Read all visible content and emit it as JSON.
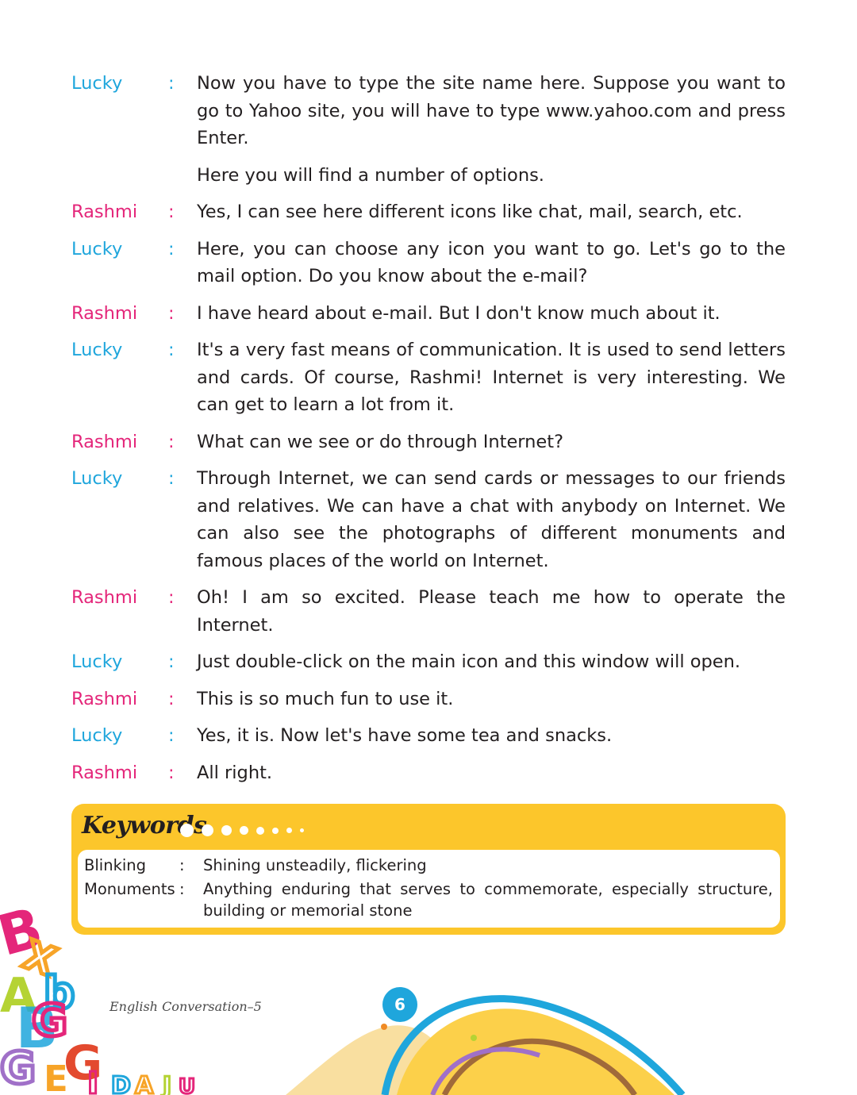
{
  "dialogue": [
    {
      "speaker": "Lucky",
      "role": "lucky",
      "colon": ":",
      "text": "Now you have to type the site name here. Suppose you want to go to Yahoo site, you will have to type www.yahoo.com and press Enter."
    },
    {
      "speaker": "",
      "role": "lucky",
      "colon": "",
      "text": "Here you will find a number of options."
    },
    {
      "speaker": "Rashmi",
      "role": "rashmi",
      "colon": ":",
      "text": "Yes, I can see here different icons like chat, mail, search, etc."
    },
    {
      "speaker": "Lucky",
      "role": "lucky",
      "colon": ":",
      "text": "Here, you can choose any icon you want to go. Let's go to the mail option. Do you know about the e-mail?"
    },
    {
      "speaker": "Rashmi",
      "role": "rashmi",
      "colon": ":",
      "text": "I have heard about e-mail. But I don't know much about it."
    },
    {
      "speaker": "Lucky",
      "role": "lucky",
      "colon": ":",
      "text": "It's a very fast means of communication. It is used to send letters and cards. Of course, Rashmi! Internet is very interesting. We can get to learn a lot from it."
    },
    {
      "speaker": "Rashmi",
      "role": "rashmi",
      "colon": ":",
      "text": "What can we see or do through Internet?"
    },
    {
      "speaker": "Lucky",
      "role": "lucky",
      "colon": ":",
      "text": "Through Internet, we can send cards or messages to our friends and relatives. We can have a chat with anybody on Internet. We can also see the photographs of different monuments and famous places of the world on Internet."
    },
    {
      "speaker": "Rashmi",
      "role": "rashmi",
      "colon": ":",
      "text": "Oh! I am so excited. Please teach me how to operate the Internet."
    },
    {
      "speaker": "Lucky",
      "role": "lucky",
      "colon": ":",
      "text": "Just double-click on the main icon and this window will open."
    },
    {
      "speaker": "Rashmi",
      "role": "rashmi",
      "colon": ":",
      "text": "This is so much fun to use it."
    },
    {
      "speaker": "Lucky",
      "role": "lucky",
      "colon": ":",
      "text": "Yes, it is. Now let's have some tea and snacks."
    },
    {
      "speaker": "Rashmi",
      "role": "rashmi",
      "colon": ":",
      "text": "All right."
    }
  ],
  "keywords": {
    "title": "Keywords",
    "items": [
      {
        "term": "Blinking",
        "colon": ":",
        "definition": "Shining unsteadily, flickering"
      },
      {
        "term": "Monuments",
        "colon": ":",
        "definition": "Anything enduring that serves to commemorate, especially structure, building or memorial stone"
      }
    ]
  },
  "footer": {
    "book_title": "English Conversation–5",
    "page_number": "6"
  },
  "colors": {
    "lucky": "#1fa6dc",
    "rashmi": "#e4267a",
    "keywords_panel": "#fcc62b"
  }
}
